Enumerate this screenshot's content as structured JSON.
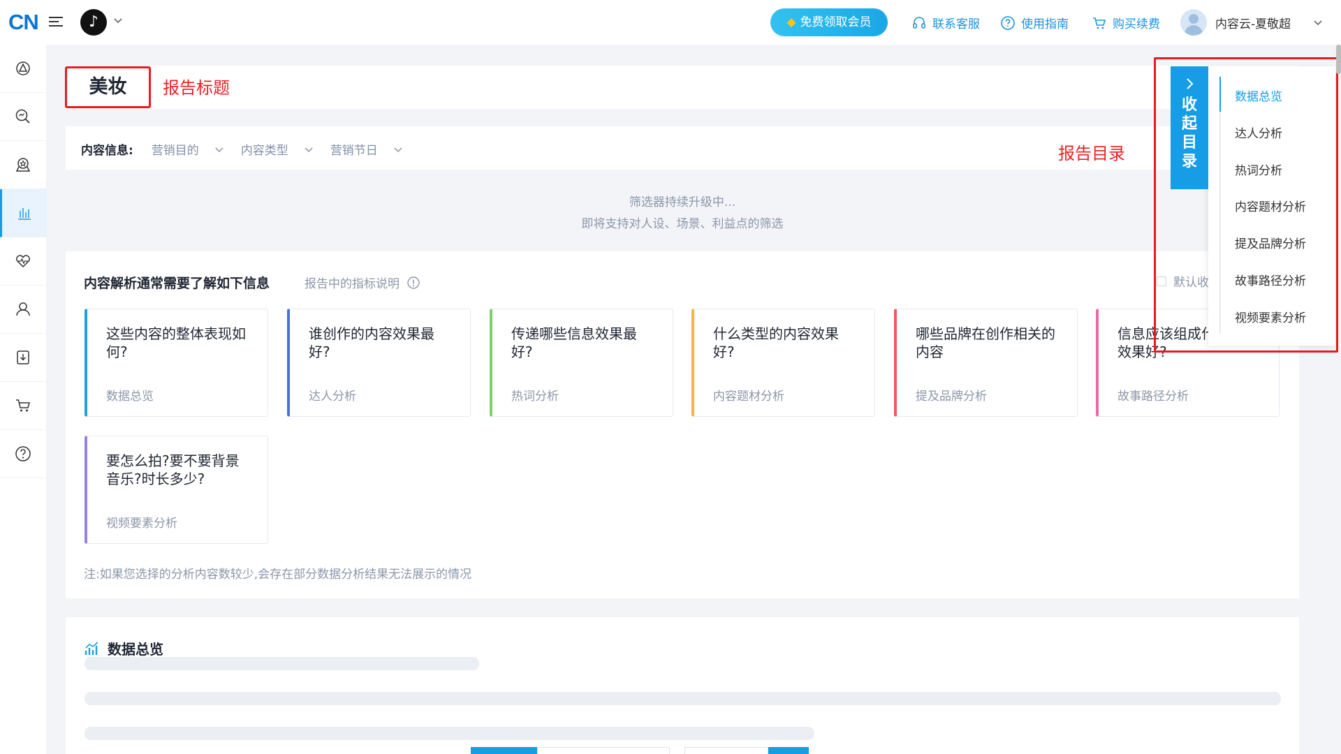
{
  "topbar": {
    "logo": "CN",
    "vip_button": "免费领取会员",
    "links": [
      "联系客服",
      "使用指南",
      "购买续费"
    ],
    "user_name": "内容云-夏敬超"
  },
  "report": {
    "title": "美妆",
    "title_annotation": "报告标题",
    "toc_annotation": "报告目录"
  },
  "filters": {
    "label": "内容信息:",
    "items": [
      "营销目的",
      "内容类型",
      "营销节日"
    ],
    "note_line1": "筛选器持续升级中...",
    "note_line2": "即将支持对人设、场景、利益点的筛选"
  },
  "analysis": {
    "heading": "内容解析通常需要了解如下信息",
    "metric_link": "报告中的指标说明",
    "default_collapse": "默认收",
    "cards": [
      {
        "question": "这些内容的整体表现如何?",
        "link": "数据总览",
        "color": "#1aa1e6"
      },
      {
        "question": "谁创作的内容效果最好?",
        "link": "达人分析",
        "color": "#4c6fd8"
      },
      {
        "question": "传递哪些信息效果最好?",
        "link": "热词分析",
        "color": "#7bd16a"
      },
      {
        "question": "什么类型的内容效果好?",
        "link": "内容题材分析",
        "color": "#f7b53b"
      },
      {
        "question": "哪些品牌在创作相关的内容",
        "link": "提及品牌分析",
        "color": "#ef5a5a"
      },
      {
        "question": "信息应该组成什么故事效果好?",
        "link": "故事路径分析",
        "color": "#ec6aa6"
      },
      {
        "question": "要怎么拍?要不要背景音乐?时长多少?",
        "link": "视频要素分析",
        "color": "#9b7ee6"
      }
    ],
    "note": "注:如果您选择的分析内容数较少,会存在部分数据分析结果无法展示的情况"
  },
  "overview": {
    "title": "数据总览"
  },
  "toc": {
    "toggle_label": "收起目录",
    "items": [
      "数据总览",
      "达人分析",
      "热词分析",
      "内容题材分析",
      "提及品牌分析",
      "故事路径分析",
      "视频要素分析"
    ],
    "active_index": 0
  },
  "colors": {
    "accent": "#169de6",
    "annotation": "#e8191f"
  }
}
